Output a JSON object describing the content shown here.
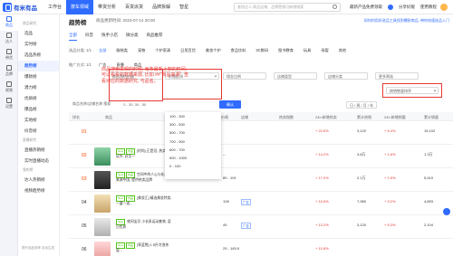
{
  "brand": {
    "name": "有米有品",
    "workbench": "工作台"
  },
  "nav": [
    "按车领域",
    "带货分析",
    "百货派货",
    "品牌拆解",
    "智星"
  ],
  "search_placeholder": "查找达人,商品店铺、品牌营销可新增搜索",
  "top_right": [
    "最新产品免费领取",
    "1",
    "分享好版",
    "使用教程"
  ],
  "rail": [
    "商品",
    "达人",
    "带货",
    "品牌",
    "视频",
    "设置"
  ],
  "sidebar": {
    "groups": [
      {
        "title": "商品研究",
        "items": [
          "选品",
          "实时榜",
          "选品热榜",
          "趋势榜",
          "爆款榜",
          "潜力榜",
          "优质榜",
          "爆品榜",
          "实地榜",
          "抖音榜"
        ]
      },
      {
        "title": "直播研究",
        "items": [
          "直播热销榜",
          "实时直播动态"
        ]
      },
      {
        "title": "我的榜",
        "items": [
          "达人热销榜",
          "视频趋势榜"
        ]
      }
    ],
    "footer": "提升选品效率 自动生成"
  },
  "page": {
    "title": "趋势榜",
    "subtitle": "商品更新时间: 2023-07-14 20:00",
    "help": "如何利用好选品工具找到爆款商品, 带你快速选品入门"
  },
  "tabs": [
    "全部",
    "抖音",
    "快手小店",
    "微分类",
    "商品推荐"
  ],
  "filters": {
    "category_label": "选品分类: 1/1",
    "categories": [
      "全部",
      "服装类",
      "宠物",
      "个护家清",
      "日用百货",
      "美妆个护",
      "食品饮料",
      "3C数码",
      "图书教育",
      "玩具",
      "母婴",
      "其他"
    ],
    "recommend_label": "推广方式: 1/1",
    "recommend_opts": [
      "广告",
      "直播",
      "商品"
    ],
    "price_label": "商品预估价格",
    "price_select": "价格区间",
    "commission_select": "佣金比例",
    "shop_type": "店铺类型",
    "shop_cat": "店铺分类",
    "more": "更多筛选",
    "toolbar_text": "商品名称/店铺名称 搜索",
    "price_range": "0 - 30, 30 - 50",
    "search_btn": "确认",
    "sort_hint": "日 / 周 / 月 / 年",
    "sort_select": "按销售量排序"
  },
  "price_dropdown": [
    "100 - 300",
    "300 - 500",
    "500 - 700",
    "700 - 900",
    "600 - 700",
    "900 - 1000",
    "0 - 100"
  ],
  "annotation": "商品搜索发现的时候, 每条最新上架的时间, 可以看看的数据来源, 比如 ##\"商品来源\", 查看对应的数据研究, 与品名。",
  "table": {
    "headers": [
      "排名",
      "商品",
      "商品价格",
      "店铺",
      "热卖指数",
      "24h 新增热卖",
      "累计热销",
      "24h 新增销量",
      "累计销量"
    ],
    "rows": [
      {
        "rank": "01",
        "title": "",
        "tags": [],
        "price": "",
        "shop": "",
        "c1": "",
        "c2": "+ 22.6%",
        "c3": "3,120",
        "c4": "+ 6.4%",
        "c5": "15,102"
      },
      {
        "rank": "02",
        "title": "[时尚] 正是冠, 热卖保证外, 好太一",
        "tags": [
          "New",
          "内品"
        ],
        "price": "--",
        "shop": "",
        "c1": "",
        "c2": "+ 14.2%",
        "c3": "3.8万",
        "c4": "+ 1.6%",
        "c5": "1.3万"
      },
      {
        "rank": "03",
        "title": "空间中的人心与化石-来源中国, 提供热卖品牌",
        "tags": [
          "New",
          "内品"
        ],
        "price": "89 - 119",
        "shop": "",
        "c1": "",
        "c2": "+ 17.0%",
        "c3": "2.1万",
        "c4": "+ 1.5%",
        "c5": "5,410"
      },
      {
        "rank": "04",
        "title": "[美妆汇] 精选美妆特卖, 一盒一送...",
        "tags": [
          "New",
          "内品"
        ],
        "price": "128",
        "shop": "广告",
        "c1": "",
        "c2": "+ 15.6%",
        "c3": "7,980",
        "c4": "+ 3.2%",
        "c5": "4,893"
      },
      {
        "rank": "05",
        "title": "夜间宝贝 小长条运动套装, 夏日优质",
        "tags": [
          "New"
        ],
        "price": "49",
        "shop": "广告",
        "c1": "",
        "c2": "+ 13.2%",
        "c3": "3,120",
        "c4": "+ 5.3%",
        "c5": "2,104"
      },
      {
        "rank": "06",
        "title": "[乖蓝熊] 1.5升冷泡茶壶...",
        "tags": [
          "New",
          "内品"
        ],
        "price": "29 - 145.9",
        "shop": "",
        "c1": "",
        "c2": "+ 10.8%",
        "c3": "",
        "c4": "",
        "c5": ""
      }
    ]
  },
  "colors": {
    "accent": "#2f6bff",
    "highlight": "#e53935",
    "up": "#e53935"
  }
}
